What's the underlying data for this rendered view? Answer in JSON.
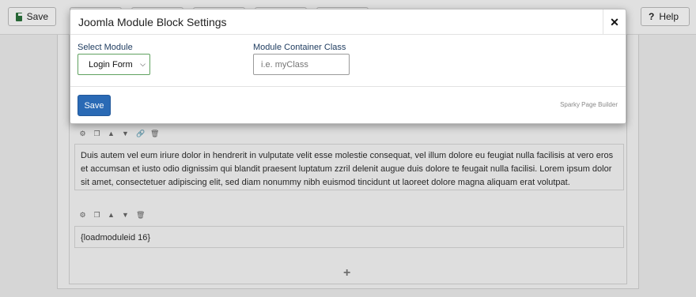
{
  "toolbar": {
    "save_label": "Save",
    "help_label": "Help",
    "save_icon": "floppy-disk-icon",
    "help_icon": "question-mark-icon"
  },
  "content": {
    "block1_text": "Duis autem vel eum iriure dolor in hendrerit in vulputate velit esse molestie consequat, vel illum dolore eu feugiat nulla facilisis at vero eros et accumsan et iusto odio dignissim qui blandit praesent luptatum zzril delenit augue duis dolore te feugait nulla facilisi. Lorem ipsum dolor sit amet, consectetuer adipiscing elit, sed diam nonummy nibh euismod tincidunt ut laoreet dolore magna aliquam erat volutpat.",
    "block2_text": "{loadmoduleid 16}",
    "add_symbol": "+",
    "block_tools": {
      "settings": "⚙",
      "copy": "❐",
      "up": "▲",
      "down": "▼",
      "link": "🔗",
      "delete": "🗑"
    }
  },
  "modal": {
    "title": "Joomla Module Block Settings",
    "close_symbol": "✕",
    "select_module_label": "Select Module",
    "select_module_value": "Login Form",
    "container_class_label": "Module Container Class",
    "container_class_placeholder": "i.e. myClass",
    "container_class_value": "",
    "save_label": "Save",
    "brand": "Sparky Page Builder"
  },
  "colors": {
    "primary": "#2a6ab5",
    "select_border": "#5fa15f",
    "label": "#1c3a5e"
  }
}
